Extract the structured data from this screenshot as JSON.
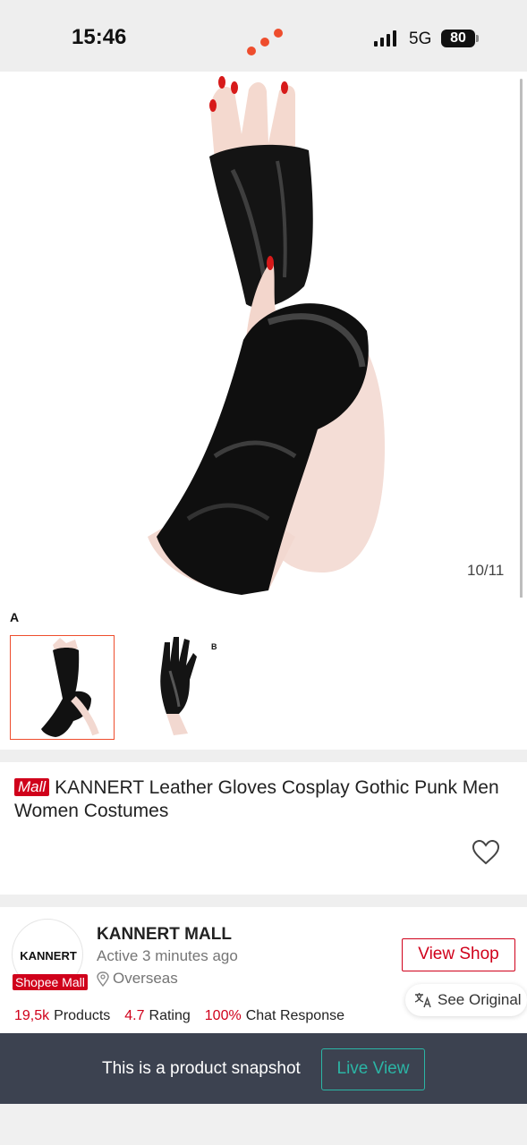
{
  "status_bar": {
    "time": "15:46",
    "network": "5G",
    "battery": "80"
  },
  "gallery": {
    "counter": "10/11",
    "variant_label": "A",
    "thumb_tag": "B"
  },
  "product": {
    "mall_badge": "Mall",
    "title": "KANNERT Leather Gloves Cosplay Gothic Punk Men Women Costumes",
    "favorite_icon": "heart-icon"
  },
  "shop": {
    "avatar_text": "KANNERT",
    "mall_badge": "Shopee Mall",
    "name": "KANNERT MALL",
    "active_status": "Active 3 minutes ago",
    "location": "Overseas",
    "view_shop_label": "View Shop",
    "see_original_label": "See Original",
    "stats": [
      {
        "value": "19,5k",
        "label": "Products"
      },
      {
        "value": "4.7",
        "label": "Rating"
      },
      {
        "value": "100%",
        "label": "Chat Response"
      }
    ]
  },
  "snapshot": {
    "text": "This is a product snapshot",
    "live_view_label": "Live View"
  },
  "colors": {
    "brand_red": "#d0011b",
    "accent_teal": "#2bb5a5",
    "snapshot_bar": "#3c4250"
  }
}
